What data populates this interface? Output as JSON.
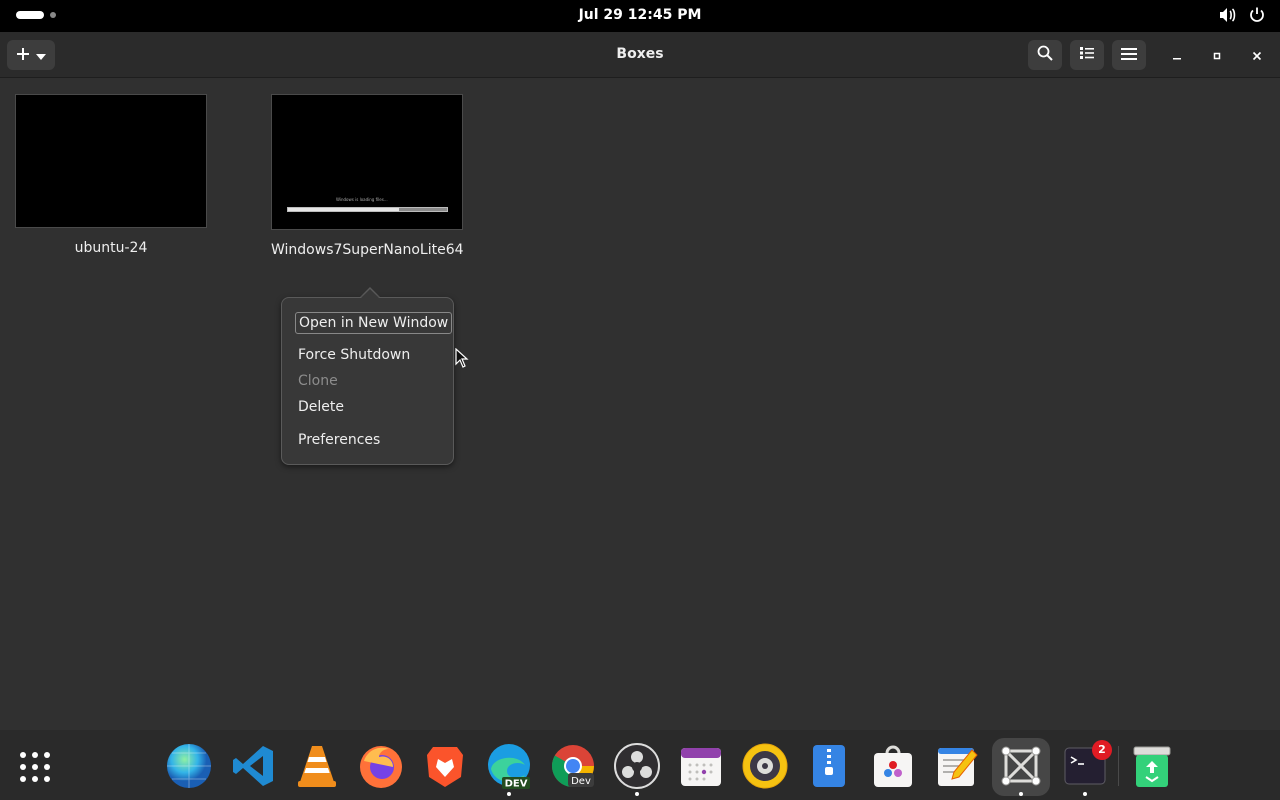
{
  "topbar": {
    "clock": "Jul 29  12:45 PM",
    "icons": [
      "activities-indicator",
      "volume-icon",
      "power-icon"
    ]
  },
  "window": {
    "title": "Boxes",
    "buttons": [
      "new-box-button",
      "search-button",
      "view-toggle-button",
      "main-menu-button",
      "minimize-button",
      "maximize-button",
      "close-button"
    ]
  },
  "boxes": [
    {
      "name": "ubuntu-24",
      "state": "blank"
    },
    {
      "name": "Windows7SuperNanoLite64",
      "state": "booting",
      "screen_text": "Windows is loading files...",
      "progress": 0.7
    }
  ],
  "context_menu": {
    "items": [
      {
        "label": "Open in New Window",
        "focused": true,
        "enabled": true
      },
      {
        "label": "Force Shutdown",
        "enabled": true
      },
      {
        "label": "Clone",
        "enabled": false
      },
      {
        "label": "Delete",
        "enabled": true
      },
      {
        "label": "Preferences",
        "enabled": true
      }
    ]
  },
  "dock": {
    "apps": [
      "show-apps",
      "web-browser",
      "vscode",
      "vlc",
      "firefox",
      "brave",
      "edge-dev",
      "chrome-dev",
      "obs-studio",
      "calendar",
      "rhythmbox",
      "file-archiver",
      "software-store",
      "text-editor",
      "boxes",
      "terminal",
      "trash"
    ],
    "terminal_badge": "2",
    "dev_label": "DEV",
    "chrome_dev_label": "Dev"
  },
  "colors": {
    "window_bg": "#303030",
    "headerbar_bg": "#2b2b2b",
    "popover_bg": "#383838",
    "dock_bg": "#2a2a2a",
    "badge": "#e01b24"
  }
}
